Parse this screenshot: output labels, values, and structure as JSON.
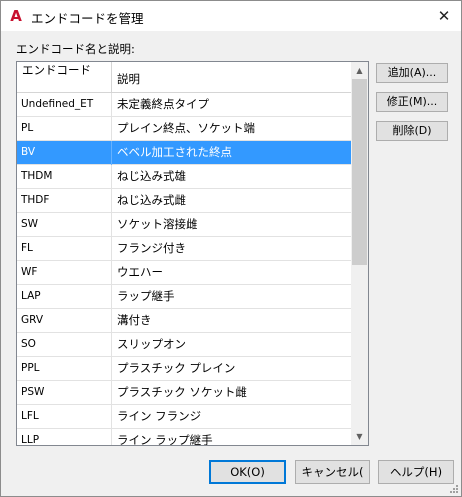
{
  "window": {
    "title": "エンドコードを管理",
    "icon": "autocad-a-icon",
    "close_glyph": "✕"
  },
  "list": {
    "label": "エンドコード名と説明:",
    "columns": {
      "code": "エンドコード",
      "description": "説明"
    },
    "selected_index": 2,
    "rows": [
      {
        "code": "Undefined_ET",
        "description": "未定義終点タイプ"
      },
      {
        "code": "PL",
        "description": "プレイン終点、ソケット端"
      },
      {
        "code": "BV",
        "description": "ベベル加工された終点"
      },
      {
        "code": "THDM",
        "description": "ねじ込み式雄"
      },
      {
        "code": "THDF",
        "description": "ねじ込み式雌"
      },
      {
        "code": "SW",
        "description": "ソケット溶接雌"
      },
      {
        "code": "FL",
        "description": "フランジ付き"
      },
      {
        "code": "WF",
        "description": "ウエハー"
      },
      {
        "code": "LAP",
        "description": "ラップ継手"
      },
      {
        "code": "GRV",
        "description": "溝付き"
      },
      {
        "code": "SO",
        "description": "スリップオン"
      },
      {
        "code": "PPL",
        "description": "プラスチック プレイン"
      },
      {
        "code": "PSW",
        "description": "プラスチック ソケット雌"
      },
      {
        "code": "LFL",
        "description": "ライン フランジ"
      },
      {
        "code": "LLP",
        "description": "ライン ラップ継手"
      }
    ]
  },
  "side_buttons": {
    "add": "追加(A)...",
    "modify": "修正(M)...",
    "delete": "削除(D)"
  },
  "footer": {
    "ok": "OK(O)",
    "cancel": "キャンセル(",
    "help": "ヘルプ(H)"
  },
  "colors": {
    "selection": "#3399ff",
    "default_button_border": "#0078d7",
    "icon_red": "#c8102e"
  }
}
